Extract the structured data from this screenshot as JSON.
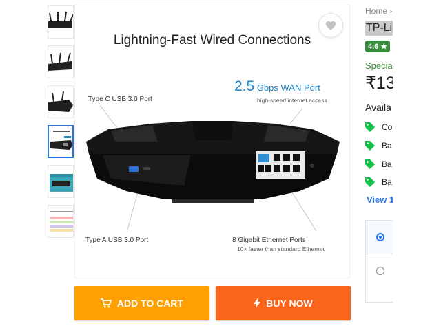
{
  "thumbnails": [
    {
      "name": "thumb-router-front"
    },
    {
      "name": "thumb-router-angle"
    },
    {
      "name": "thumb-router-side"
    },
    {
      "name": "thumb-wired-connections",
      "selected": true
    },
    {
      "name": "thumb-router-box"
    },
    {
      "name": "thumb-comparison-chart"
    }
  ],
  "image": {
    "title": "Lightning-Fast Wired Connections",
    "typec_label": "Type C USB 3.0 Port",
    "typea_label": "Type A USB 3.0 Port",
    "wan_speed": "2.5",
    "wan_unit": " Gbps WAN Port",
    "wan_sub": "high-speed internet access",
    "eth_label": "8 Gigabit Ethernet Ports",
    "eth_sub": "10× faster than standard Ethernet"
  },
  "actions": {
    "add_to_cart": "ADD TO CART",
    "buy_now": "BUY NOW"
  },
  "details": {
    "breadcrumb_home": "Home",
    "breadcrumb_sep": "›",
    "title": "TP-Li",
    "rating": "4.6 ★",
    "special_price": "Special",
    "price": "₹13",
    "available_offers": "Availa",
    "offers": [
      "Co",
      "Ba",
      "Ba",
      "Ba"
    ],
    "view_more": "View 1"
  },
  "colors": {
    "add_to_cart": "#ff9f00",
    "buy_now": "#fb641b",
    "rating_green": "#388e3c",
    "link_blue": "#2874f0",
    "wan_blue": "#1d86c8"
  }
}
